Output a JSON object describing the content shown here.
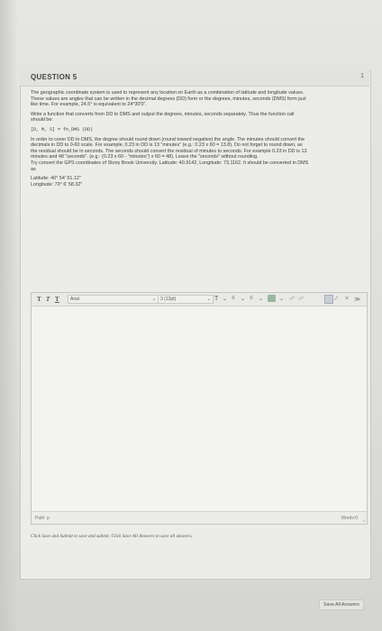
{
  "question": {
    "title": "QUESTION 5",
    "points": "1",
    "paragraphs": [
      "The geographic coordinate system is used to represent any location on Earth as a combination of latitude and longitude values.",
      "These values are angles that can be written in the decimal degrees (DD) form or the degrees, minutes, seconds (DMS) form just",
      "like time. For example, 24.5° is equivalent to 24°30'0\".",
      "Write a function that converts from DD to DMS and output the degrees, minutes, seconds separately. Thus the function call",
      "should be:"
    ],
    "code_line": "[D, M, S] = fn_DMS (DD)",
    "paragraphs2": [
      "In order to cover DD to DMS, the degree should round down (round toward negative) the angle. The minutes should convert the",
      "decimals in DD to 0-60 scale. For example, 0.23 in DD is 13 \"minutes\" (e.g.: 0.23 x 60 = 13.8). Do not forget to round down, as",
      "the residual should be in seconds. The seconds should convert the residual of minutes to seconds. For example 0.23 in DD is 13",
      "minutes and 48 \"seconds\". (e.g.: (0.23 x 60 - \"minutes\") x 60 = 48). Leave the \"seconds\" without rounding.",
      "Try convert the GPS coordinates of Stony Brook University. Latitude: 40.9142, Longitude: 73.1162. It should be converted in DMS",
      "as"
    ],
    "latitude": "Latitude: 40° 54' 51.12\"",
    "longitude": "Longitude: 73° 6' 58.32\""
  },
  "editor": {
    "bold": "T",
    "italic": "T",
    "underline": "T",
    "font_select": "Arial",
    "size_select": "3 (12pt)",
    "path_label": "Path: p",
    "words_label": "Words:0"
  },
  "footer": {
    "instructions": "Click Save and Submit to save and submit. Click Save All Answers to save all answers.",
    "save_all": "Save All Answers"
  },
  "colors": {
    "background": "#dcdcd8",
    "panel": "#ececea",
    "border": "#c7c7c3"
  }
}
